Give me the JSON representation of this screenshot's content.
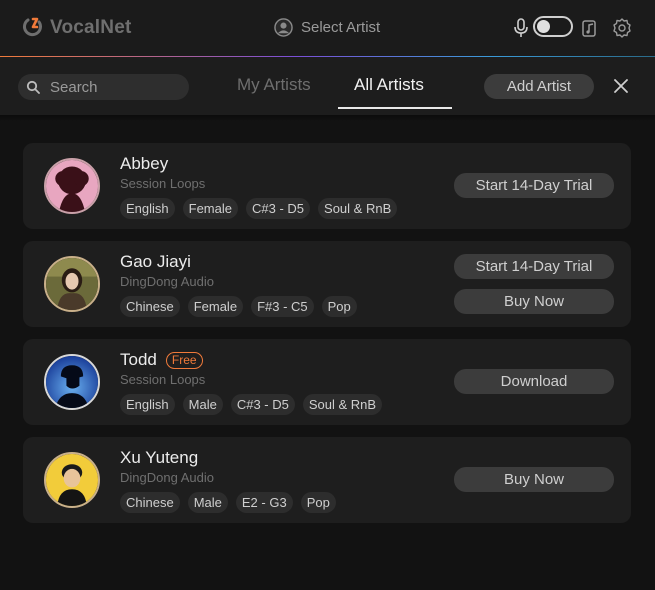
{
  "app": {
    "name": "VocalNet",
    "accent": "#f07a3a"
  },
  "header": {
    "select_artist": "Select Artist",
    "toggle_state": "off"
  },
  "toolbar": {
    "search_placeholder": "Search",
    "tabs": [
      {
        "label": "My Artists",
        "active": false
      },
      {
        "label": "All Artists",
        "active": true
      }
    ],
    "add_artist": "Add Artist"
  },
  "artists": [
    {
      "name": "Abbey",
      "badge": "",
      "studio": "Session Loops",
      "tags": [
        "English",
        "Female",
        "C#3 - D5",
        "Soul & RnB"
      ],
      "buttons": [
        "Start 14-Day Trial"
      ]
    },
    {
      "name": "Gao Jiayi",
      "badge": "",
      "studio": "DingDong Audio",
      "tags": [
        "Chinese",
        "Female",
        "F#3 - C5",
        "Pop"
      ],
      "buttons": [
        "Start 14-Day Trial",
        "Buy Now"
      ]
    },
    {
      "name": "Todd",
      "badge": "Free",
      "studio": "Session Loops",
      "tags": [
        "English",
        "Male",
        "C#3 - D5",
        "Soul & RnB"
      ],
      "buttons": [
        "Download"
      ]
    },
    {
      "name": "Xu Yuteng",
      "badge": "",
      "studio": "DingDong Audio",
      "tags": [
        "Chinese",
        "Male",
        "E2 - G3",
        "Pop"
      ],
      "buttons": [
        "Buy Now"
      ]
    }
  ]
}
